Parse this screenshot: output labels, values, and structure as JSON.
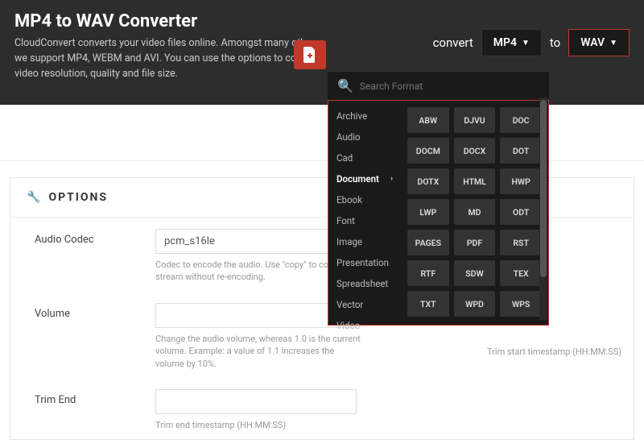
{
  "header": {
    "title": "MP4 to WAV Converter",
    "description": "CloudConvert converts your video files online. Amongst many others, we support MP4, WEBM and AVI. You can use the options to control video resolution, quality and file size."
  },
  "convert": {
    "label": "convert",
    "from": "MP4",
    "to_label": "to",
    "to": "WAV"
  },
  "dropdown": {
    "search_placeholder": "Search Format",
    "categories": [
      "Archive",
      "Audio",
      "Cad",
      "Document",
      "Ebook",
      "Font",
      "Image",
      "Presentation",
      "Spreadsheet",
      "Vector",
      "Video"
    ],
    "active_category": "Document",
    "formats": [
      "ABW",
      "DJVU",
      "DOC",
      "DOCM",
      "DOCX",
      "DOT",
      "DOTX",
      "HTML",
      "HWP",
      "LWP",
      "MD",
      "ODT",
      "PAGES",
      "PDF",
      "RST",
      "RTF",
      "SDW",
      "TEX",
      "TXT",
      "WPD",
      "WPS"
    ]
  },
  "options": {
    "heading": "OPTIONS",
    "audio_codec": {
      "label": "Audio Codec",
      "value": "pcm_s16le",
      "hint": "Codec to encode the audio. Use \"copy\" to copy the stream without re-encoding."
    },
    "volume": {
      "label": "Volume",
      "value": "",
      "hint": "Change the audio volume, whereas 1.0 is the current volume. Example: a value of 1.1 increases the volume by 10%."
    },
    "trim_start_hint": "Trim start timestamp (HH:MM:SS)",
    "trim_end": {
      "label": "Trim End",
      "value": "",
      "hint": "Trim end timestamp (HH:MM:SS)"
    }
  }
}
